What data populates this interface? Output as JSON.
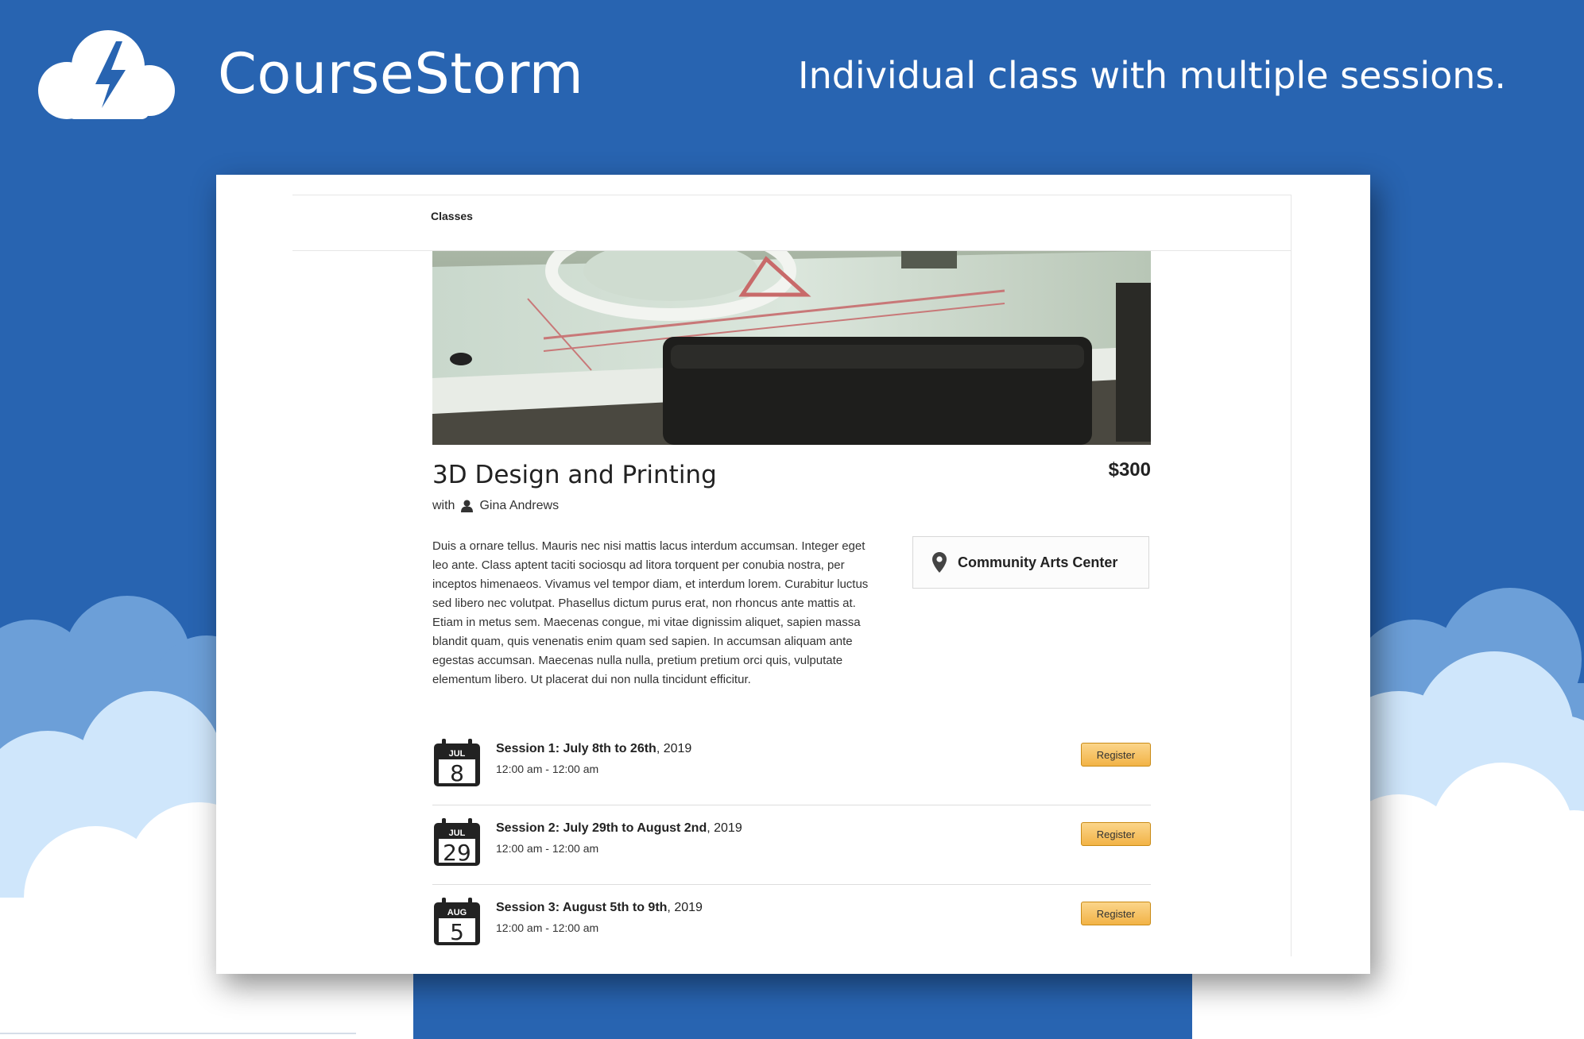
{
  "brand": {
    "name": "CourseStorm",
    "tagline": "Individual class with multiple sessions."
  },
  "nav": {
    "classes_label": "Classes"
  },
  "course": {
    "title": "3D Design and Printing",
    "price": "$300",
    "instructor_prefix": "with",
    "instructor_name": "Gina Andrews",
    "description": "Duis a ornare tellus. Mauris nec nisi mattis lacus interdum accumsan. Integer eget leo ante. Class aptent taciti sociosqu ad litora torquent per conubia nostra, per inceptos himenaeos. Vivamus vel tempor diam, et interdum lorem. Curabitur luctus sed libero nec volutpat. Phasellus dictum purus erat, non rhoncus ante mattis at. Etiam in metus sem. Maecenas congue, mi vitae dignissim aliquet, sapien massa blandit quam, quis venenatis enim quam sed sapien. In accumsan aliquam ante egestas accumsan. Maecenas nulla nulla, pretium pretium orci quis, vulputate elementum libero. Ut placerat dui non nulla tincidunt efficitur.",
    "location": "Community Arts Center"
  },
  "sessions": [
    {
      "title_bold": "Session 1: July 8th to 26th",
      "year": ", 2019",
      "time": "12:00 am - 12:00 am",
      "cal_month": "JUL",
      "cal_day": "8",
      "register_label": "Register"
    },
    {
      "title_bold": "Session 2: July 29th to August 2nd",
      "year": ", 2019",
      "time": "12:00 am - 12:00 am",
      "cal_month": "JUL",
      "cal_day": "29",
      "register_label": "Register"
    },
    {
      "title_bold": "Session 3: August 5th to 9th",
      "year": ", 2019",
      "time": "12:00 am - 12:00 am",
      "cal_month": "AUG",
      "cal_day": "5",
      "register_label": "Register"
    }
  ],
  "colors": {
    "background": "#2864b1",
    "cloud_light": "#cfe6fb",
    "cloud_mid": "#9ec6ee",
    "button": "#f2b346"
  },
  "icons": {
    "logo": "cloud-lightning-icon",
    "instructor": "person-icon",
    "location": "map-pin-icon",
    "session": "calendar-icon"
  }
}
